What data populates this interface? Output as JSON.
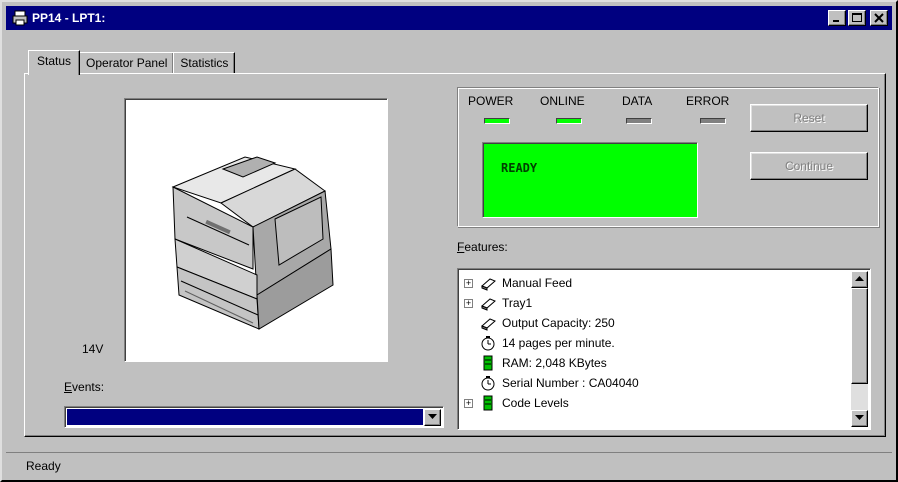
{
  "window": {
    "title": "PP14 - LPT1:"
  },
  "tabs": [
    {
      "label": "Status",
      "active": true
    },
    {
      "label": "Operator Panel",
      "active": false
    },
    {
      "label": "Statistics",
      "active": false
    }
  ],
  "printer": {
    "model": "14V"
  },
  "events": {
    "label": "Events:",
    "selected": ""
  },
  "operator_panel": {
    "leds": [
      {
        "label": "POWER",
        "color": "#00ff00"
      },
      {
        "label": "ONLINE",
        "color": "#00ff00"
      },
      {
        "label": "DATA",
        "color": "#808080"
      },
      {
        "label": "ERROR",
        "color": "#808080"
      }
    ],
    "display_text": "READY",
    "display_color": "#00ff00",
    "reset_label": "Reset",
    "continue_label": "Continue"
  },
  "features": {
    "label": "Features:",
    "items": [
      {
        "text": "Manual Feed",
        "icon": "paper-tray-icon",
        "expandable": true
      },
      {
        "text": "Tray1",
        "icon": "paper-tray-icon",
        "expandable": true
      },
      {
        "text": "Output Capacity: 250",
        "icon": "paper-tray-icon",
        "expandable": false
      },
      {
        "text": "14 pages per minute.",
        "icon": "stopwatch-icon",
        "expandable": false
      },
      {
        "text": "RAM:  2,048 KBytes",
        "icon": "memory-chip-icon",
        "expandable": false
      },
      {
        "text": "Serial Number :  CA04040",
        "icon": "stopwatch-icon",
        "expandable": false
      },
      {
        "text": "Code Levels",
        "icon": "memory-chip-icon",
        "expandable": true
      }
    ]
  },
  "status_bar": {
    "text": "Ready"
  }
}
